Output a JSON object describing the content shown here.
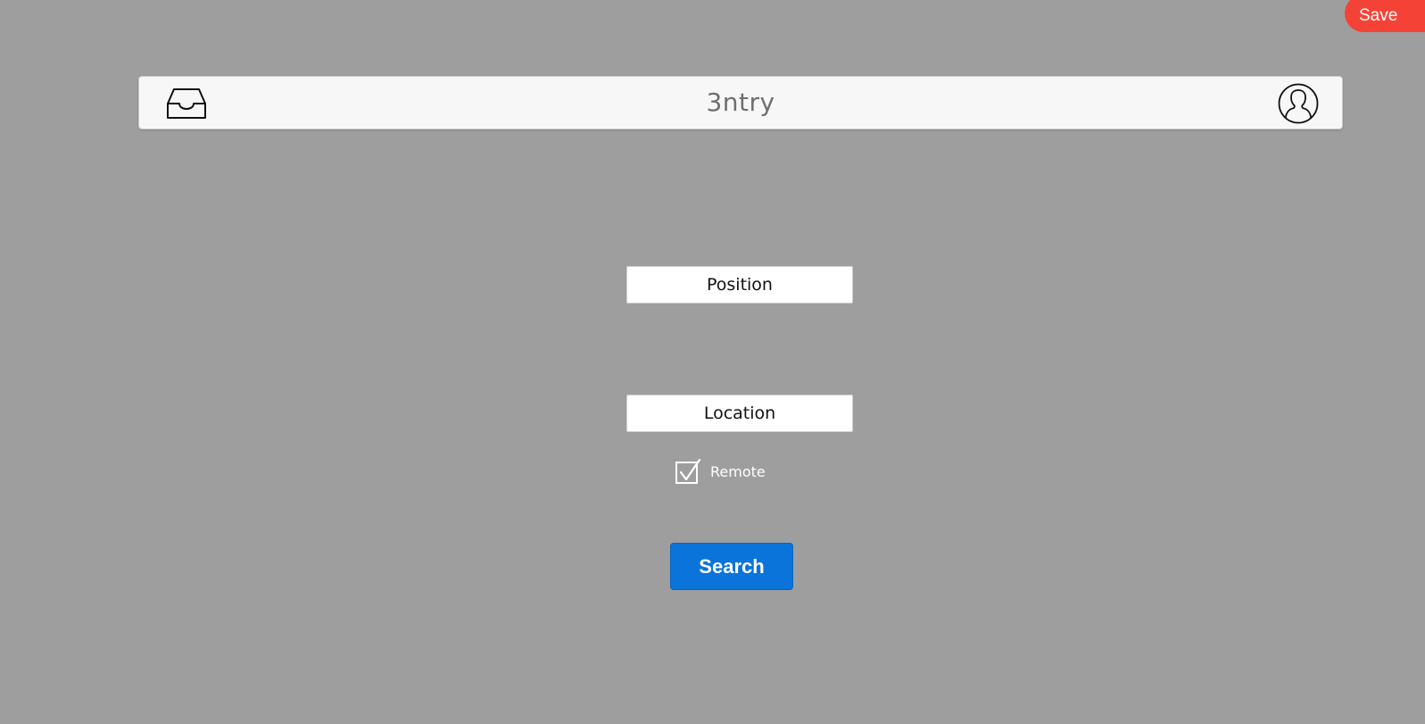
{
  "toolbar": {
    "save_label": "Save"
  },
  "header": {
    "title": "3ntry",
    "left_icon": "inbox-icon",
    "right_icon": "user-profile-icon"
  },
  "form": {
    "position_placeholder": "Position",
    "location_placeholder": "Location",
    "remote_label": "Remote",
    "remote_checked": true,
    "search_label": "Search"
  },
  "colors": {
    "background": "#9e9e9e",
    "save_button": "#f44336",
    "search_button": "#0a74da",
    "header_bar": "#f7f7f7"
  }
}
